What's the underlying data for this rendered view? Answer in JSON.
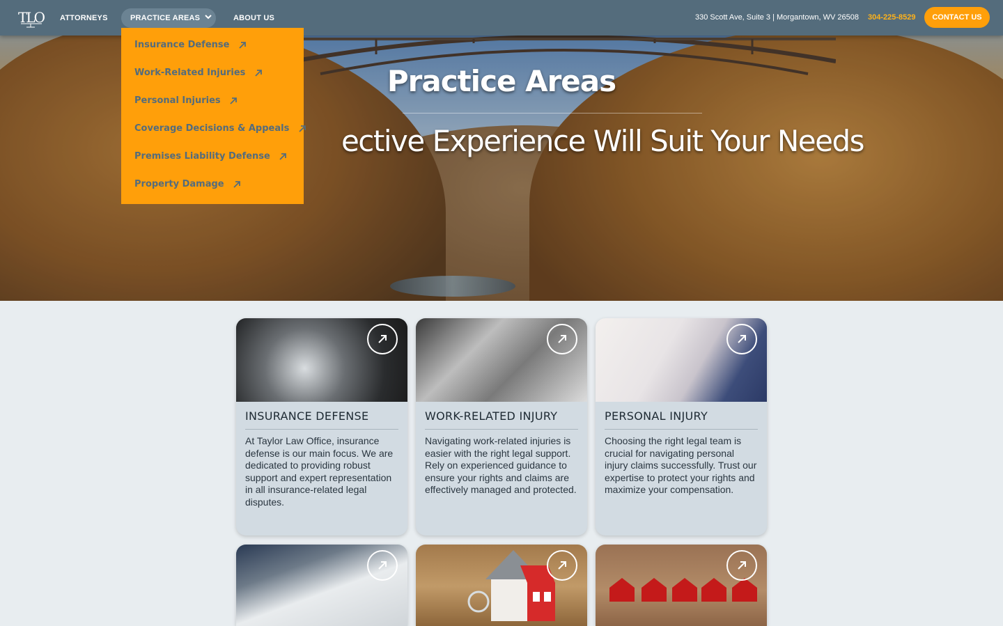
{
  "nav": {
    "logo_text": "TLO",
    "links": [
      "ATTORNEYS",
      "PRACTICE AREAS",
      "ABOUT US"
    ],
    "address": "330 Scott Ave, Suite 3 | Morgantown, WV 26508",
    "phone": "304-225-8529",
    "contact_label": "CONTACT US"
  },
  "dropdown": {
    "items": [
      "Insurance Defense",
      "Work-Related Injuries",
      "Personal Injuries",
      "Coverage Decisions & Appeals",
      "Premises Liability Defense",
      "Property Damage"
    ]
  },
  "hero": {
    "title": "Practice Areas",
    "subtitle": "ective Experience Will Suit Your Needs"
  },
  "cards": [
    {
      "title": "INSURANCE DEFENSE",
      "body": "At Taylor Law Office, insurance defense is our main focus. We are dedicated to providing robust support and expert representation in all insurance-related legal disputes."
    },
    {
      "title": "WORK-RELATED INJURY",
      "body": "Navigating work-related injuries is easier with the right legal support. Rely on experienced guidance to ensure your rights and claims are effectively managed and protected."
    },
    {
      "title": "PERSONAL INJURY",
      "body": "Choosing the right legal team is crucial for navigating personal injury claims successfully. Trust our expertise to protect your rights and maximize your compensation."
    }
  ],
  "colors": {
    "nav_bg": "#546c7c",
    "accent": "#ff9f0a",
    "phone": "#ffb21a",
    "page_bg": "#e8edf0",
    "card_bg": "#d2dbe2"
  }
}
